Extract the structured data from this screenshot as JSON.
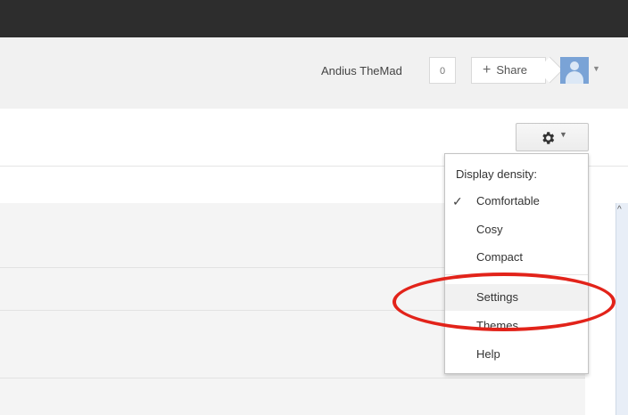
{
  "header": {
    "username": "Andius TheMad",
    "count": "0",
    "share_label": "Share",
    "share_icon": "plus-icon",
    "avatar_icon": "avatar-icon",
    "avatar_caret_icon": "caret-down-icon"
  },
  "toolbar": {
    "settings_button_icon": "gear-icon",
    "settings_caret_icon": "caret-down-icon"
  },
  "menu": {
    "heading": "Display density:",
    "items": [
      {
        "label": "Comfortable",
        "checked": true
      },
      {
        "label": "Cosy",
        "checked": false
      },
      {
        "label": "Compact",
        "checked": false
      },
      {
        "label": "Settings",
        "checked": false,
        "highlighted": true
      },
      {
        "label": "Themes",
        "checked": false
      },
      {
        "label": "Help",
        "checked": false
      }
    ]
  },
  "colors": {
    "topbar": "#2d2d2d",
    "header_bg": "#f1f1f1",
    "highlight": "#e2231a",
    "avatar": "#7aa3d6"
  }
}
